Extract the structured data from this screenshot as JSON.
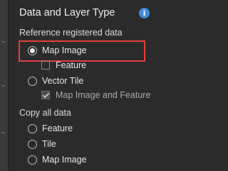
{
  "panel": {
    "title": "Data and Layer Type",
    "info_icon": "info-icon",
    "reference_group": {
      "label": "Reference registered data",
      "options": [
        {
          "label": "Map Image",
          "selected": true
        },
        {
          "label": "Feature",
          "type": "checkbox",
          "checked": false
        },
        {
          "label": "Vector Tile",
          "selected": false
        },
        {
          "label": "Map Image and Feature",
          "type": "checkbox",
          "checked": true,
          "disabled": true
        }
      ]
    },
    "copy_group": {
      "label": "Copy all data",
      "options": [
        {
          "label": "Feature",
          "selected": false
        },
        {
          "label": "Tile",
          "selected": false
        },
        {
          "label": "Map Image",
          "selected": false
        }
      ]
    }
  },
  "colors": {
    "background": "#2b2b2b",
    "highlight": "#e0403f",
    "info_accent": "#3f8cd6"
  }
}
